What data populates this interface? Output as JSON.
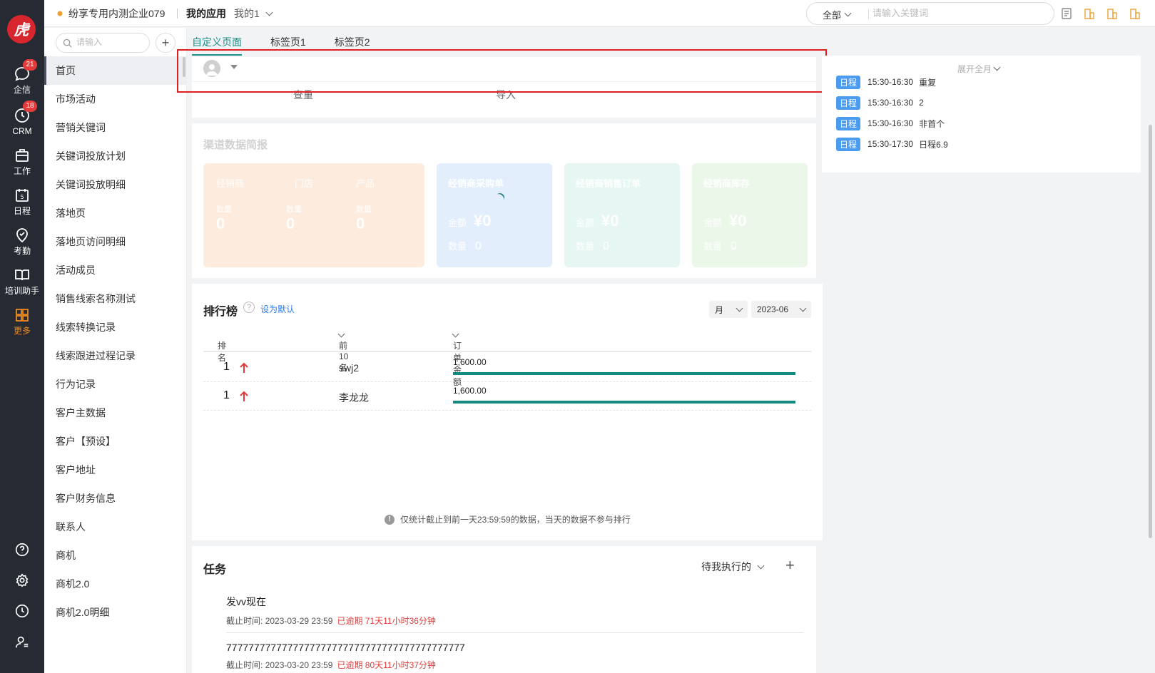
{
  "logo_text": "虎",
  "rail": {
    "items": [
      {
        "label": "企信",
        "badge": "21"
      },
      {
        "label": "CRM",
        "badge": "18"
      },
      {
        "label": "工作"
      },
      {
        "label": "日程",
        "icon_text": "5"
      },
      {
        "label": "考勤"
      },
      {
        "label": "培训助手"
      },
      {
        "label": "更多"
      }
    ],
    "bottom_icons": [
      "help-icon",
      "settings-icon",
      "clock-icon",
      "user-settings-icon"
    ]
  },
  "topbar": {
    "company": "纷享专用内测企业079",
    "app_name": "我的应用",
    "app_sub": "我的1",
    "search_scope": "全部",
    "search_placeholder": "请输入关键词"
  },
  "subnav": {
    "search_placeholder": "请输入",
    "add": "+",
    "items": [
      "首页",
      "市场活动",
      "营销关键词",
      "关键词投放计划",
      "关键词投放明细",
      "落地页",
      "落地页访问明细",
      "活动成员",
      "销售线索名称测试",
      "线索转换记录",
      "线索跟进过程记录",
      "行为记录",
      "客户主数据",
      "客户【预设】",
      "客户地址",
      "客户财务信息",
      "联系人",
      "商机",
      "商机2.0",
      "商机2.0明细"
    ]
  },
  "tabs": [
    "自定义页面",
    "标签页1",
    "标签页2"
  ],
  "quick_actions": {
    "dedupe": "查重",
    "import": "导入"
  },
  "channel": {
    "title": "渠道数据简报",
    "dealer_tabs": [
      "经销商",
      "门店",
      "产品"
    ],
    "dealer_values": [
      {
        "label": "数量",
        "value": "0"
      },
      {
        "label": "数量",
        "value": "0"
      },
      {
        "label": "数量",
        "value": "0"
      }
    ],
    "cards": [
      {
        "title": "经销商采购单",
        "amount_label": "金额",
        "amount": "¥0",
        "count_label": "数量",
        "count": "0"
      },
      {
        "title": "经销商销售订单",
        "amount_label": "金额",
        "amount": "¥0",
        "count_label": "数量",
        "count": "0"
      },
      {
        "title": "经销商库存",
        "amount_label": "金额",
        "amount": "¥0",
        "count_label": "数量",
        "count": "0"
      }
    ]
  },
  "ranking": {
    "title": "排行榜",
    "help": "?",
    "set_default": "设为默认",
    "period": "月",
    "month": "2023-06",
    "columns": [
      "排名",
      "前10名",
      "订单金额"
    ],
    "rows": [
      {
        "rank": "1",
        "name": "swj2",
        "amount": "1,600.00",
        "fill": 1.0
      },
      {
        "rank": "1",
        "name": "李龙龙",
        "amount": "1,600.00",
        "fill": 1.0
      }
    ],
    "note": "仅统计截止到前一天23:59:59的数据，当天的数据不参与排行"
  },
  "tasks": {
    "title": "任务",
    "filter": "待我执行的",
    "add": "+",
    "items": [
      {
        "name": "发vv现在",
        "deadline_label": "截止时间:",
        "deadline": "2023-03-29 23:59",
        "overdue": "已逾期 71天11小时36分钟"
      },
      {
        "name": "7777777777777777777777777777777777777777777",
        "deadline_label": "截止时间:",
        "deadline": "2023-03-20 23:59",
        "overdue": "已逾期 80天11小时37分钟"
      }
    ]
  },
  "schedule": {
    "expand": "展开全月",
    "items": [
      {
        "tag": "日程",
        "time": "15:30-16:30",
        "title": "重复"
      },
      {
        "tag": "日程",
        "time": "15:30-16:30",
        "title": "2"
      },
      {
        "tag": "日程",
        "time": "15:30-16:30",
        "title": "非首个"
      },
      {
        "tag": "日程",
        "time": "15:30-17:30",
        "title": "日程6.9"
      }
    ]
  },
  "colors": {
    "accent": "#1a8f8a",
    "rail_bg": "#262a33",
    "rail_active": "#f08a24",
    "badge": "#e63b3b",
    "overdue": "#e23b3b",
    "highlight_box": "#e02020",
    "link": "#2c7be5"
  }
}
